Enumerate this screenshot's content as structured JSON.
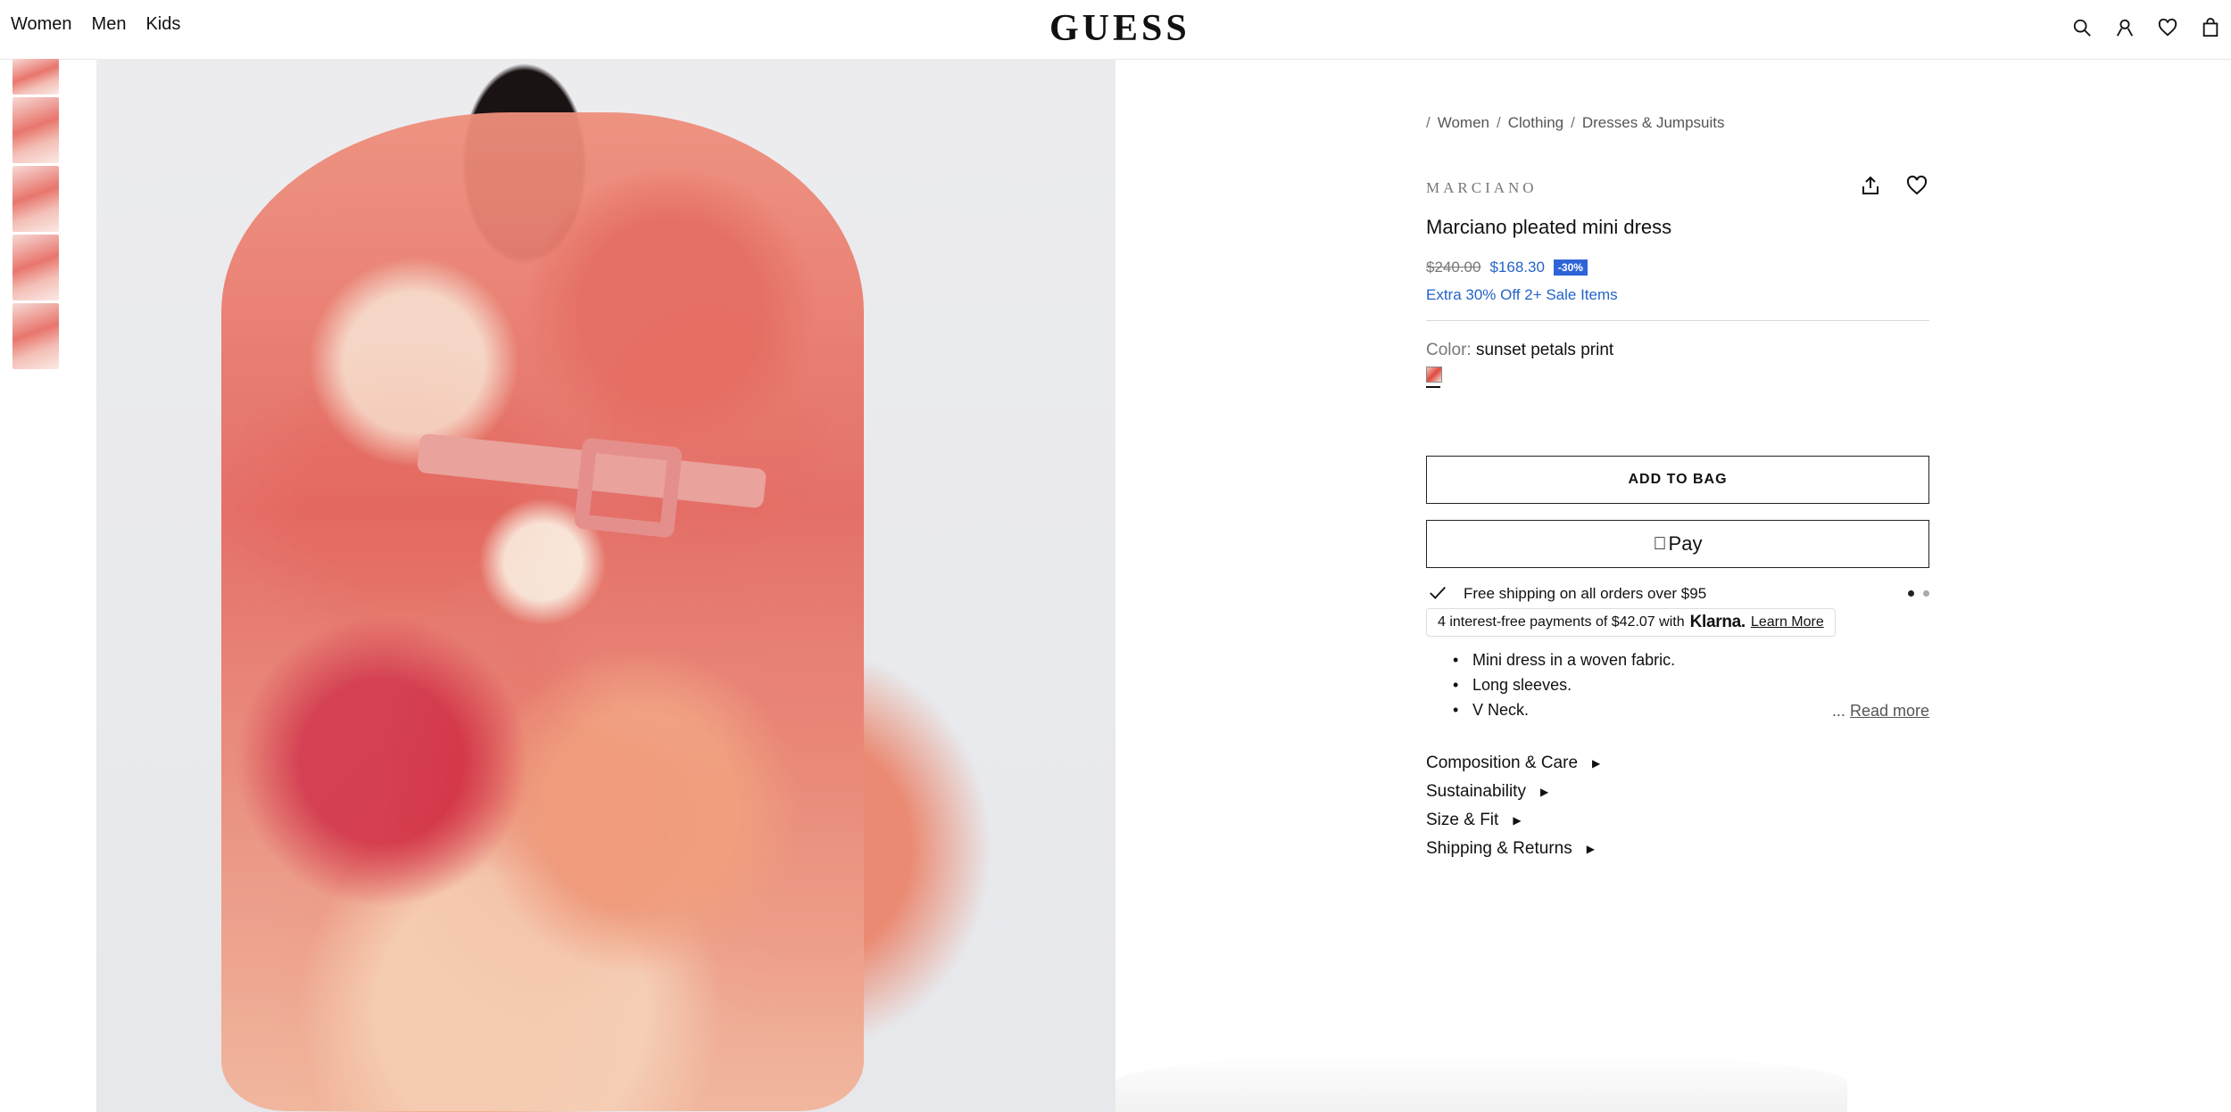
{
  "header": {
    "nav": [
      "Women",
      "Men",
      "Kids"
    ],
    "logo": "GUESS",
    "icons": [
      "search-icon",
      "account-icon",
      "wishlist-icon",
      "bag-icon"
    ]
  },
  "breadcrumb": {
    "items": [
      "Women",
      "Clothing",
      "Dresses & Jumpsuits"
    ],
    "separator": "/"
  },
  "product": {
    "brand": "MARCIANO",
    "title": "Marciano pleated mini dress",
    "price_original": "$240.00",
    "price_sale": "$168.30",
    "discount_badge": "-30%",
    "promo": "Extra 30% Off 2+ Sale Items",
    "color_label": "Color:",
    "color_value": "sunset petals print"
  },
  "actions": {
    "add_to_bag": "ADD TO BAG",
    "apple_pay": "Pay"
  },
  "shipping": {
    "message": "Free shipping on all orders over $95"
  },
  "klarna": {
    "text": "4 interest-free payments of $42.07 with",
    "brand": "Klarna.",
    "learn_more": "Learn More"
  },
  "features": [
    "Mini dress in a woven fabric.",
    "Long sleeves.",
    "V Neck."
  ],
  "read_more": {
    "ellipsis": "...",
    "label": "Read more"
  },
  "accordion": [
    "Composition & Care",
    "Sustainability",
    "Size & Fit",
    "Shipping & Returns"
  ],
  "colors": {
    "accent_blue": "#2563c9",
    "badge_blue": "#2f64d8"
  }
}
